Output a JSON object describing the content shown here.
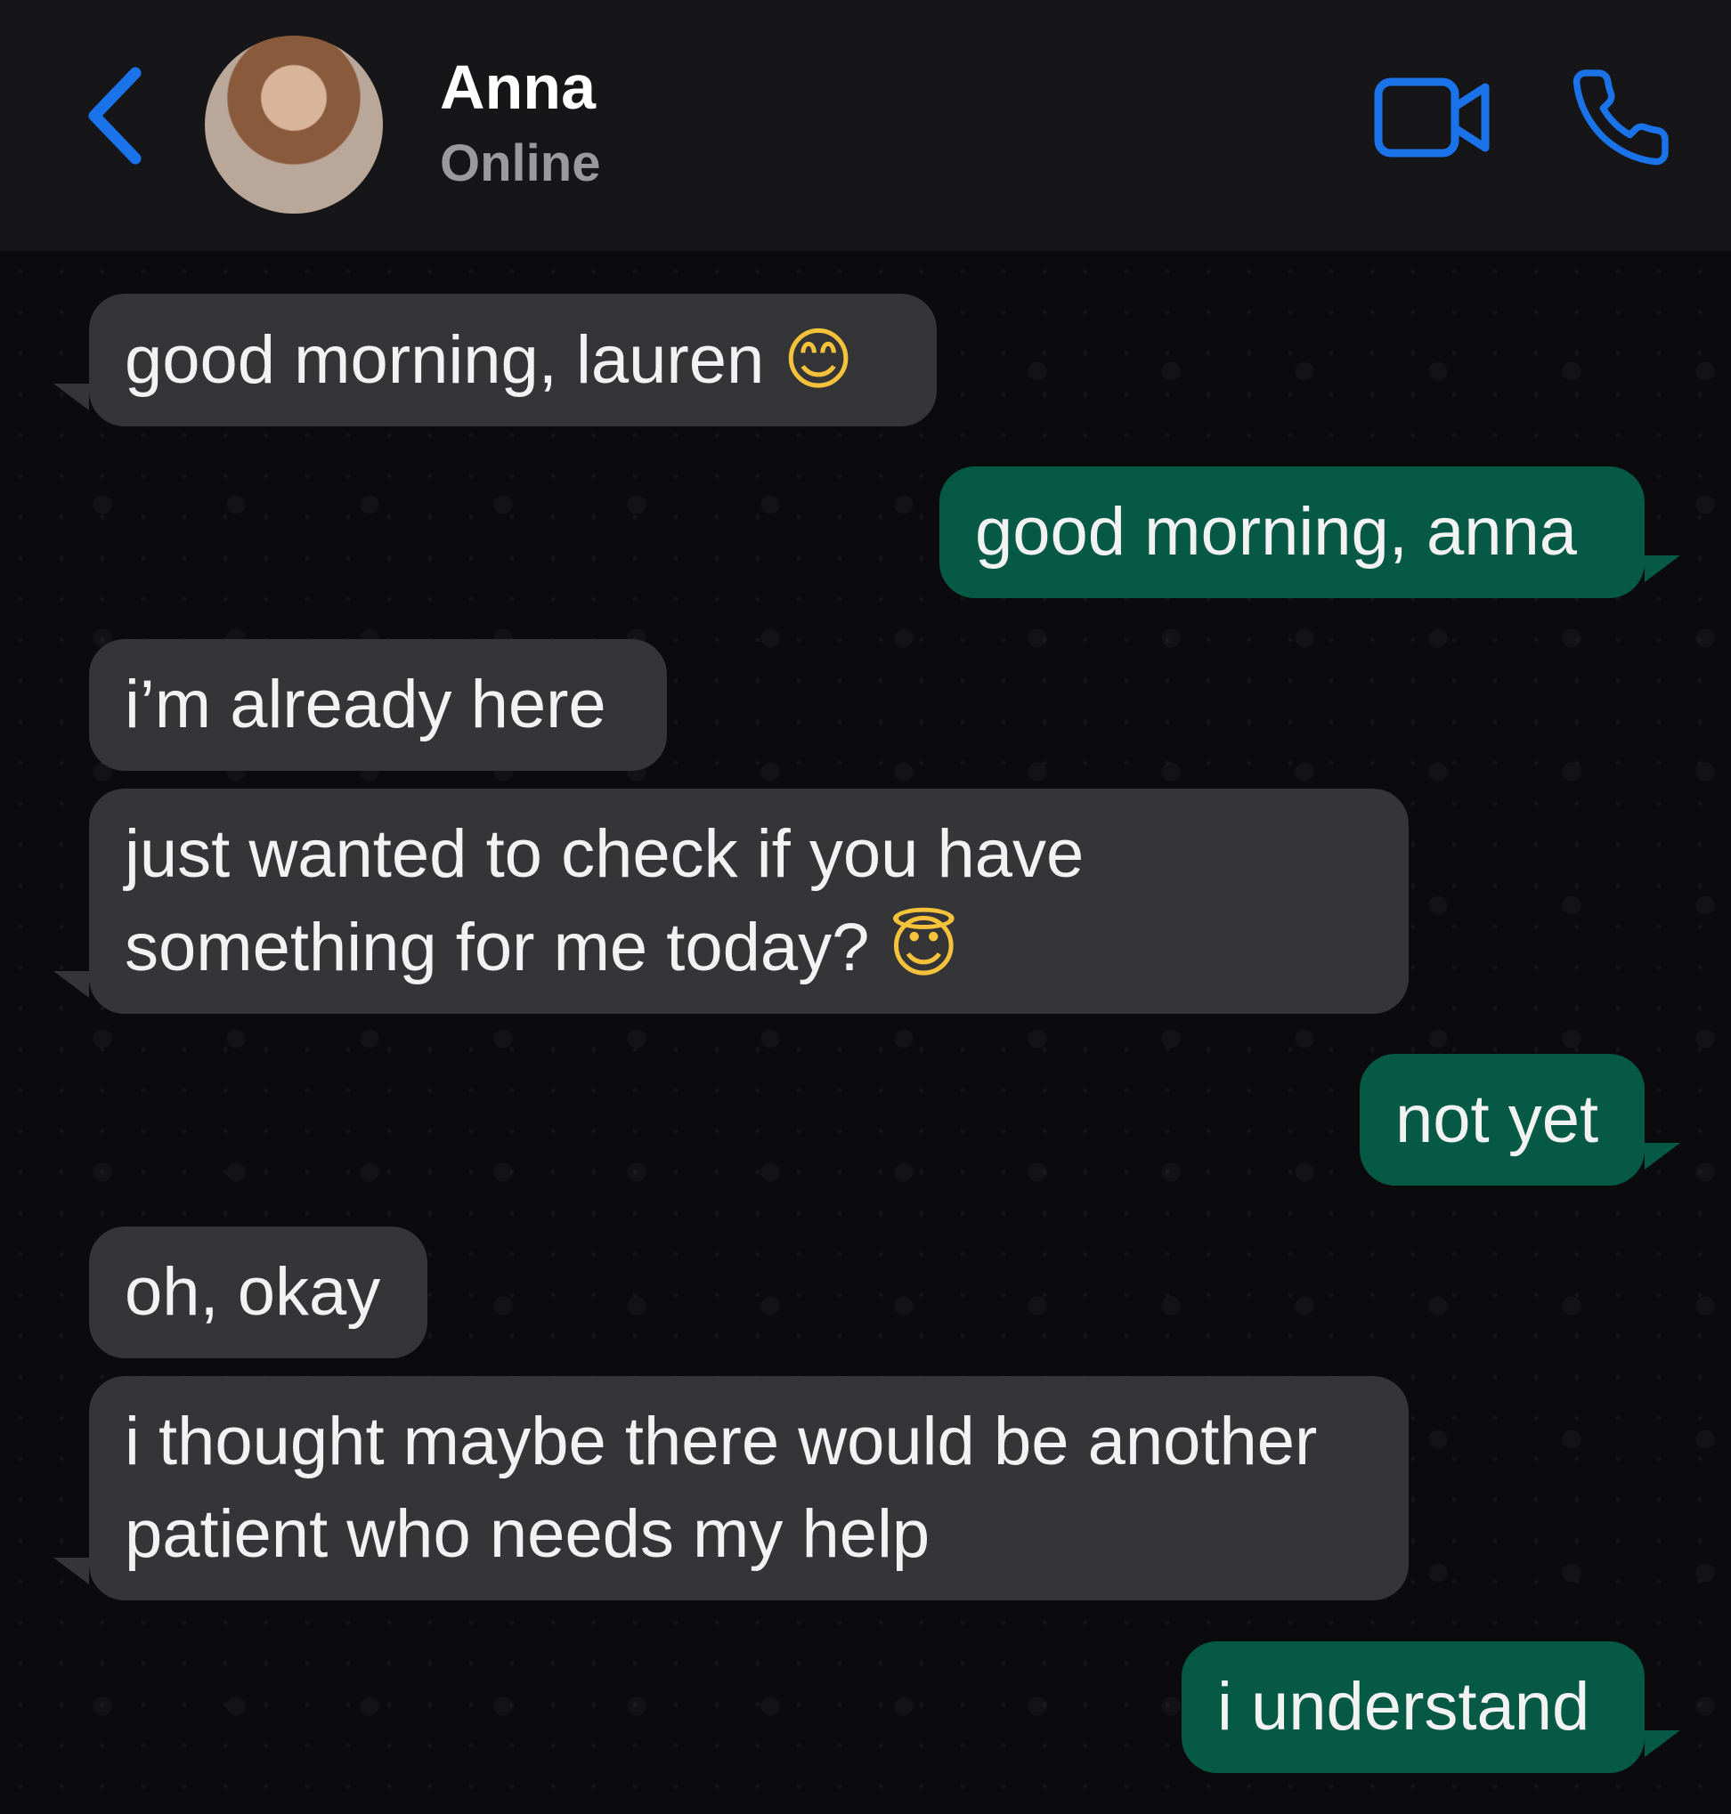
{
  "header": {
    "contact_name": "Anna",
    "status": "Online",
    "accent_color": "#1a73e8"
  },
  "messages": [
    {
      "direction": "incoming",
      "text": "good morning, lauren",
      "emoji": "😊"
    },
    {
      "direction": "outgoing",
      "text": "good morning, anna"
    },
    {
      "direction": "incoming",
      "text": "i’m already here"
    },
    {
      "direction": "incoming",
      "text": "just wanted to check if you have something for me today?",
      "emoji": "😇"
    },
    {
      "direction": "outgoing",
      "text": "not yet"
    },
    {
      "direction": "incoming",
      "text": "oh, okay"
    },
    {
      "direction": "incoming",
      "text": "i thought maybe there would be another patient who needs my help"
    },
    {
      "direction": "outgoing",
      "text": "i understand"
    }
  ],
  "colors": {
    "incoming_bubble": "#353537",
    "outgoing_bubble": "#065a45",
    "background": "#0b0b0d",
    "header": "#161618"
  },
  "icons": [
    "chevron-left-icon",
    "video-camera-icon",
    "phone-icon"
  ]
}
